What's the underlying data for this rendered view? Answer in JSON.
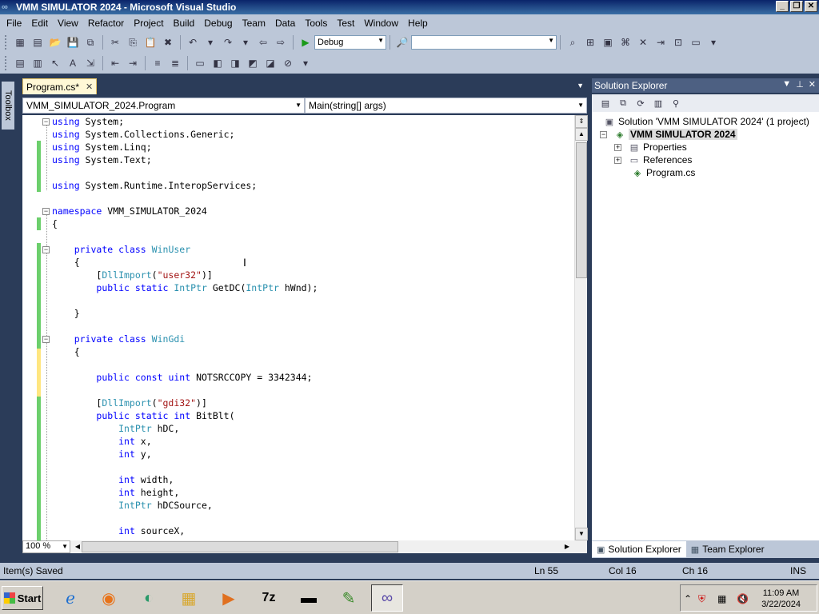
{
  "window": {
    "title": "VMM SIMULATOR 2024 - Microsoft Visual Studio",
    "minimize": "_",
    "restore": "❐",
    "close": "✕"
  },
  "menu": [
    "File",
    "Edit",
    "View",
    "Refactor",
    "Project",
    "Build",
    "Debug",
    "Team",
    "Data",
    "Tools",
    "Test",
    "Window",
    "Help"
  ],
  "toolbar": {
    "config_value": "Debug",
    "platform_value": ""
  },
  "toolbox": {
    "label": "Toolbox"
  },
  "editor": {
    "tab_label": "Program.cs*",
    "type_dropdown": "VMM_SIMULATOR_2024.Program",
    "member_dropdown": "Main(string[] args)",
    "zoom": "100 %"
  },
  "code_lines": [
    [
      [
        "kw",
        "using"
      ],
      [
        "p",
        " System;"
      ]
    ],
    [
      [
        "kw",
        "using"
      ],
      [
        "p",
        " System.Collections.Generic;"
      ]
    ],
    [
      [
        "kw",
        "using"
      ],
      [
        "p",
        " System.Linq;"
      ]
    ],
    [
      [
        "kw",
        "using"
      ],
      [
        "p",
        " System.Text;"
      ]
    ],
    [],
    [
      [
        "kw",
        "using"
      ],
      [
        "p",
        " System.Runtime.InteropServices;"
      ]
    ],
    [],
    [
      [
        "kw",
        "namespace"
      ],
      [
        "p",
        " VMM_SIMULATOR_2024"
      ]
    ],
    [
      [
        "p",
        "{"
      ]
    ],
    [],
    [
      [
        "p",
        "    "
      ],
      [
        "kw",
        "private"
      ],
      [
        "p",
        " "
      ],
      [
        "kw",
        "class"
      ],
      [
        "p",
        " "
      ],
      [
        "ty",
        "WinUser"
      ]
    ],
    [
      [
        "p",
        "    {"
      ]
    ],
    [
      [
        "p",
        "        ["
      ],
      [
        "ty",
        "DllImport"
      ],
      [
        "p",
        "("
      ],
      [
        "st",
        "\"user32\""
      ],
      [
        "p",
        ")]"
      ]
    ],
    [
      [
        "p",
        "        "
      ],
      [
        "kw",
        "public"
      ],
      [
        "p",
        " "
      ],
      [
        "kw",
        "static"
      ],
      [
        "p",
        " "
      ],
      [
        "ty",
        "IntPtr"
      ],
      [
        "p",
        " GetDC("
      ],
      [
        "ty",
        "IntPtr"
      ],
      [
        "p",
        " hWnd);"
      ]
    ],
    [],
    [
      [
        "p",
        "    }"
      ]
    ],
    [],
    [
      [
        "p",
        "    "
      ],
      [
        "kw",
        "private"
      ],
      [
        "p",
        " "
      ],
      [
        "kw",
        "class"
      ],
      [
        "p",
        " "
      ],
      [
        "ty",
        "WinGdi"
      ]
    ],
    [
      [
        "p",
        "    {"
      ]
    ],
    [],
    [
      [
        "p",
        "        "
      ],
      [
        "kw",
        "public"
      ],
      [
        "p",
        " "
      ],
      [
        "kw",
        "const"
      ],
      [
        "p",
        " "
      ],
      [
        "kw",
        "uint"
      ],
      [
        "p",
        " NOTSRCCOPY = 3342344;"
      ]
    ],
    [],
    [
      [
        "p",
        "        ["
      ],
      [
        "ty",
        "DllImport"
      ],
      [
        "p",
        "("
      ],
      [
        "st",
        "\"gdi32\""
      ],
      [
        "p",
        ")]"
      ]
    ],
    [
      [
        "p",
        "        "
      ],
      [
        "kw",
        "public"
      ],
      [
        "p",
        " "
      ],
      [
        "kw",
        "static"
      ],
      [
        "p",
        " "
      ],
      [
        "kw",
        "int"
      ],
      [
        "p",
        " BitBlt("
      ]
    ],
    [
      [
        "p",
        "            "
      ],
      [
        "ty",
        "IntPtr"
      ],
      [
        "p",
        " hDC,"
      ]
    ],
    [
      [
        "p",
        "            "
      ],
      [
        "kw",
        "int"
      ],
      [
        "p",
        " x,"
      ]
    ],
    [
      [
        "p",
        "            "
      ],
      [
        "kw",
        "int"
      ],
      [
        "p",
        " y,"
      ]
    ],
    [],
    [
      [
        "p",
        "            "
      ],
      [
        "kw",
        "int"
      ],
      [
        "p",
        " width,"
      ]
    ],
    [
      [
        "p",
        "            "
      ],
      [
        "kw",
        "int"
      ],
      [
        "p",
        " height,"
      ]
    ],
    [
      [
        "p",
        "            "
      ],
      [
        "ty",
        "IntPtr"
      ],
      [
        "p",
        " hDCSource,"
      ]
    ],
    [],
    [
      [
        "p",
        "            "
      ],
      [
        "kw",
        "int"
      ],
      [
        "p",
        " sourceX,"
      ]
    ]
  ],
  "solution_explorer": {
    "title": "Solution Explorer",
    "solution": "Solution 'VMM SIMULATOR 2024' (1 project)",
    "project": "VMM SIMULATOR 2024",
    "items": [
      "Properties",
      "References",
      "Program.cs"
    ],
    "tab_solution": "Solution Explorer",
    "tab_team": "Team Explorer"
  },
  "status": {
    "message": "Item(s) Saved",
    "ln": "Ln 55",
    "col": "Col 16",
    "ch": "Ch 16",
    "mode": "INS"
  },
  "taskbar": {
    "start": "Start",
    "time": "11:09 AM",
    "date": "3/22/2024"
  },
  "colors": {
    "keyword": "#0000ff",
    "type": "#2b91af",
    "string": "#a31515",
    "change_saved": "#6ccf6c",
    "change_unsaved": "#ffe680"
  }
}
